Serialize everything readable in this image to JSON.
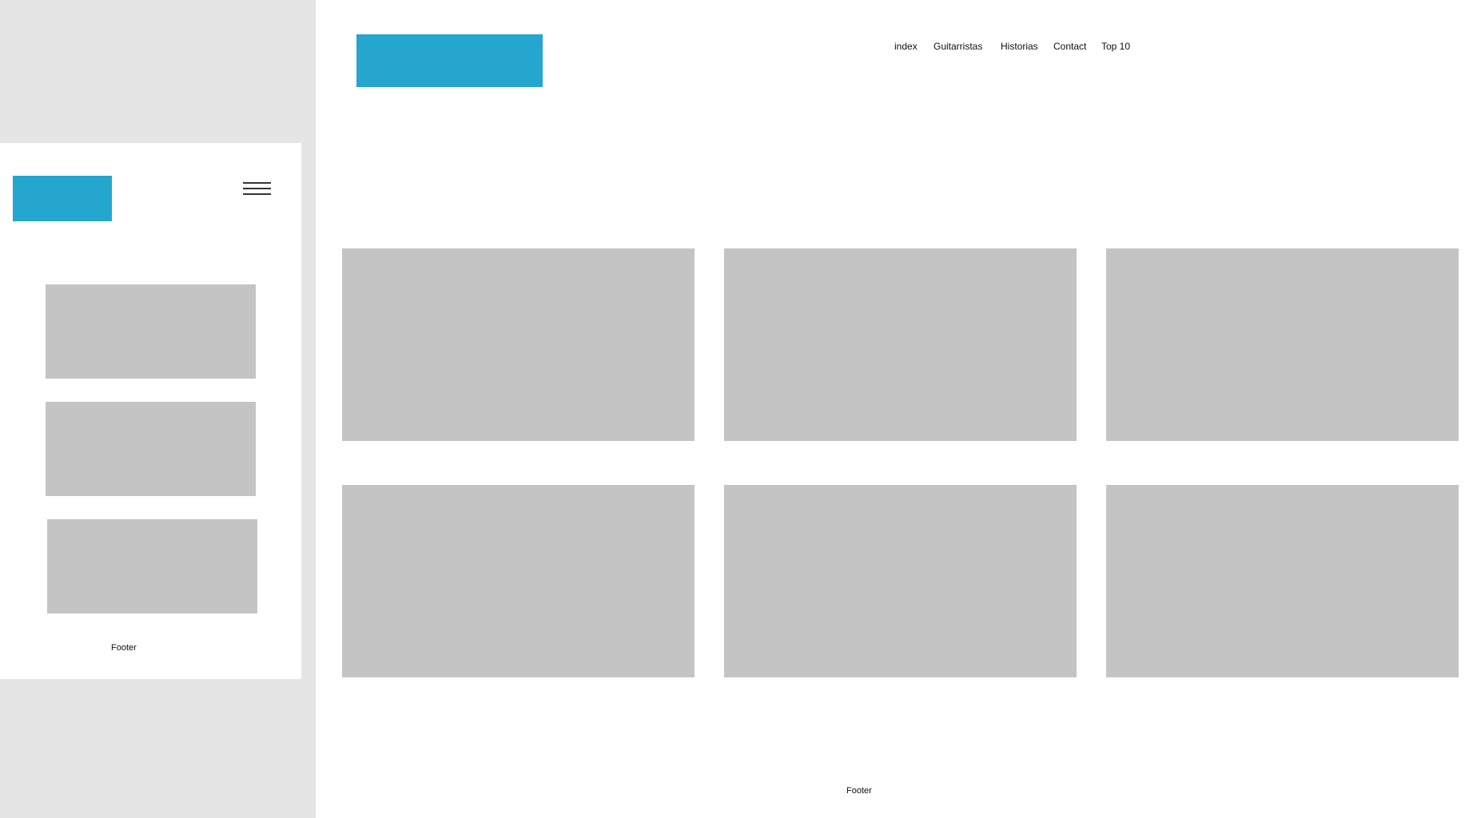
{
  "mobile": {
    "footer": "Footer",
    "menu_icon": "hamburger-menu-icon"
  },
  "desktop": {
    "nav": {
      "items": [
        {
          "label": "index"
        },
        {
          "label": "Guitarristas"
        },
        {
          "label": "Historias"
        },
        {
          "label": "Contact"
        },
        {
          "label": "Top 10"
        }
      ]
    },
    "footer": "Footer"
  },
  "colors": {
    "logo_placeholder": "#24a6ce",
    "content_placeholder": "#c4c4c4",
    "canvas_background": "#e5e5e5"
  }
}
